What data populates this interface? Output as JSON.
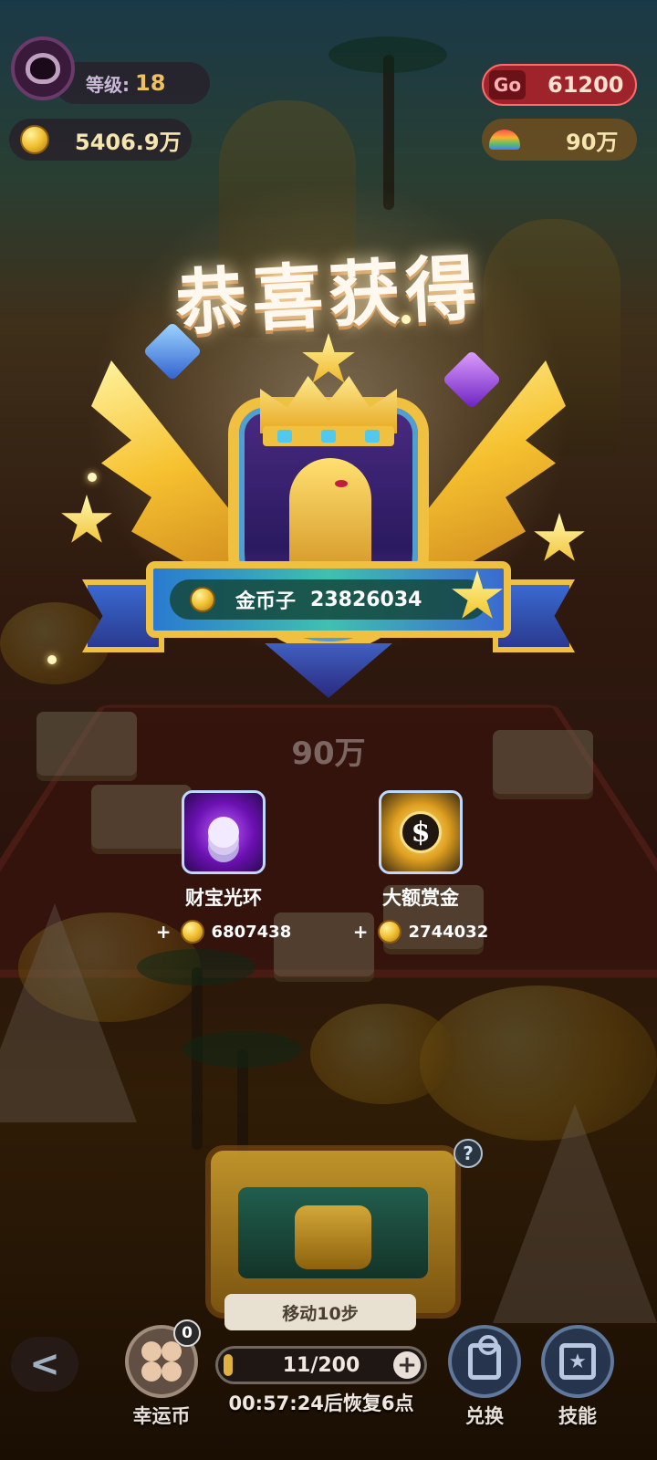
{
  "hud": {
    "level_label": "等级:",
    "level_value": "18",
    "coins": "5406.9万",
    "go_badge": "Go",
    "go_value": "61200",
    "rainbow_value": "90万"
  },
  "reward": {
    "title": "恭喜获得",
    "item_name": "金币子",
    "item_amount": "23826034",
    "under_value": "90万"
  },
  "bonuses": [
    {
      "name": "财宝光环",
      "plus": "+",
      "amount": "6807438",
      "icon": "treasure-aura-icon"
    },
    {
      "name": "大额赏金",
      "plus": "+",
      "amount": "2744032",
      "icon": "big-bounty-icon"
    }
  ],
  "board": {
    "help": "?",
    "move_label": "移动10步"
  },
  "bottom": {
    "back_glyph": "<",
    "lucky_badge": "0",
    "lucky_label": "幸运币",
    "energy_text": "11/200",
    "energy_current": 11,
    "energy_max": 200,
    "energy_plus": "+",
    "timer_text": "00:57:24后恢复6点",
    "exchange_label": "兑换",
    "skill_label": "技能"
  },
  "colors": {
    "accent_gold": "#f0c040",
    "go_red": "#b41e28",
    "ribbon_blue": "#3a6ad0"
  }
}
